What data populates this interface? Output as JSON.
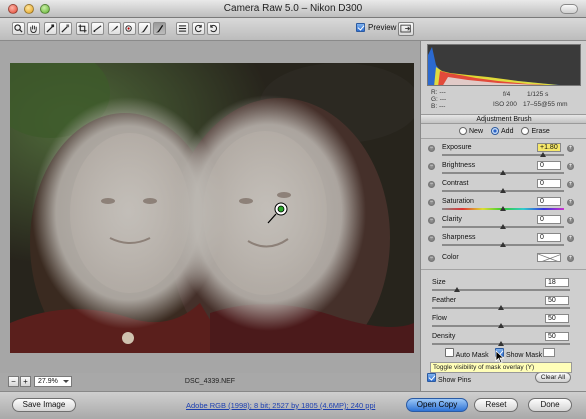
{
  "window": {
    "title": "Camera Raw 5.0  –  Nikon D300"
  },
  "toolbar": {
    "tools": [
      {
        "name": "zoom-tool-icon"
      },
      {
        "name": "hand-tool-icon"
      },
      {
        "name": "white-balance-tool-icon"
      },
      {
        "name": "color-sampler-tool-icon"
      },
      {
        "name": "crop-tool-icon"
      },
      {
        "name": "straighten-tool-icon"
      },
      {
        "name": "spot-removal-tool-icon"
      },
      {
        "name": "red-eye-tool-icon"
      },
      {
        "name": "adjustment-brush-tool-icon"
      },
      {
        "name": "graduated-filter-tool-icon"
      },
      {
        "name": "preferences-icon"
      },
      {
        "name": "rotate-ccw-icon"
      },
      {
        "name": "rotate-cw-icon"
      }
    ],
    "preview_label": "Preview",
    "preview_checked": true
  },
  "readout": {
    "r_label": "R:",
    "g_label": "G:",
    "b_label": "B:",
    "r_value": "---",
    "g_value": "---",
    "b_value": "---",
    "aperture": "f/4",
    "shutter": "1/125 s",
    "iso": "ISO 200",
    "lens": "17–55@55 mm"
  },
  "panel": {
    "title": "Adjustment Brush",
    "modes": [
      {
        "label": "New",
        "selected": false
      },
      {
        "label": "Add",
        "selected": true
      },
      {
        "label": "Erase",
        "selected": false
      }
    ],
    "adjustments": [
      {
        "label": "Exposure",
        "value": "+1.80",
        "highlight": true,
        "thumb_fraction": 0.83
      },
      {
        "label": "Brightness",
        "value": "0",
        "highlight": false,
        "thumb_fraction": 0.5
      },
      {
        "label": "Contrast",
        "value": "0",
        "highlight": false,
        "thumb_fraction": 0.5
      },
      {
        "label": "Saturation",
        "value": "0",
        "highlight": false,
        "thumb_fraction": 0.5
      },
      {
        "label": "Clarity",
        "value": "0",
        "highlight": false,
        "thumb_fraction": 0.5
      },
      {
        "label": "Sharpness",
        "value": "0",
        "highlight": false,
        "thumb_fraction": 0.5
      }
    ],
    "color_label": "Color",
    "brush": [
      {
        "label": "Size",
        "value": "18",
        "thumb_fraction": 0.18
      },
      {
        "label": "Feather",
        "value": "50",
        "thumb_fraction": 0.5
      },
      {
        "label": "Flow",
        "value": "50",
        "thumb_fraction": 0.5
      },
      {
        "label": "Density",
        "value": "50",
        "thumb_fraction": 0.5
      }
    ],
    "auto_mask_label": "Auto Mask",
    "auto_mask_checked": false,
    "show_mask_label": "Show Mask",
    "show_mask_checked": true,
    "show_pins_label": "Show Pins",
    "show_pins_checked": true,
    "clear_all_label": "Clear All",
    "tooltip": "Toggle visibility of mask overlay (Y)"
  },
  "canvas": {
    "zoom_value": "27.9%",
    "zoom_out_label": "−",
    "zoom_in_label": "+",
    "filename": "DSC_4339.NEF"
  },
  "bottom": {
    "save_label": "Save Image",
    "workflow": "Adobe RGB (1998); 8 bit; 2527 by 1805 (4.6MP); 240 ppi",
    "open_label": "Open Copy",
    "reset_label": "Reset",
    "done_label": "Done"
  },
  "colors": {
    "highlight_field": "#f6e86a",
    "primary_button": "#2f73d6",
    "workflow_link": "#1c3fb0"
  }
}
